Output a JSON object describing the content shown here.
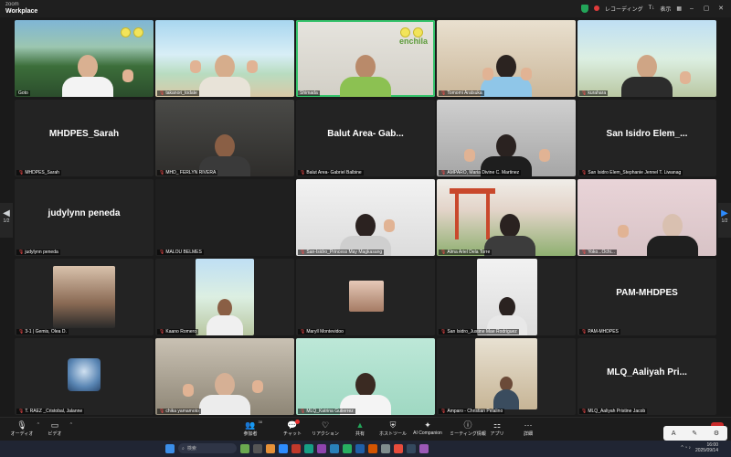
{
  "app": {
    "logo_line1": "zoom",
    "logo_line2": "Workplace"
  },
  "titlebar": {
    "recording_label": "レコーディング",
    "view_label": "表示",
    "ti_label": "T↓"
  },
  "pager": {
    "left": "1/2",
    "right": "1/2"
  },
  "tiles": [
    {
      "name": "Goto",
      "type": "video",
      "bg": "jungle",
      "active": false
    },
    {
      "name": "takanori_todate",
      "type": "video",
      "bg": "beach",
      "active": false,
      "mic_off": true
    },
    {
      "name": "Shimada",
      "type": "video",
      "bg": "room-light",
      "active": true,
      "overlay_text": "enchila"
    },
    {
      "name": "Tomomi Aratsuka",
      "type": "video",
      "bg": "room-warm",
      "active": false,
      "mic_off": true
    },
    {
      "name": "kurahara",
      "type": "video",
      "bg": "palm",
      "active": false,
      "mic_off": true
    },
    {
      "name": "MHDPES_Sarah",
      "type": "name",
      "display": "MHDPES_Sarah",
      "mic_off": true
    },
    {
      "name": "MHD_ FERLYN RIVERA",
      "type": "video",
      "bg": "dark",
      "mic_off": true
    },
    {
      "name": "Balut Area- Gabriel Balbine",
      "type": "name",
      "display": "Balut Area- Gab...",
      "mic_off": true
    },
    {
      "name": "AMPARO, Maria Divine C. Martinez",
      "type": "video",
      "bg": "gray",
      "mic_off": true
    },
    {
      "name": "San Isidro Elem_Stephanie Jennel T. Liwanag",
      "type": "name",
      "display": "San Isidro Elem_...",
      "mic_off": true
    },
    {
      "name": "judylynn peneda",
      "type": "name",
      "display": "judylynn peneda",
      "mic_off": true
    },
    {
      "name": "MALOU BELMES",
      "type": "blank",
      "mic_off": true
    },
    {
      "name": "San-Isidro_Princess May Magkasang",
      "type": "video",
      "bg": "white",
      "mic_off": true
    },
    {
      "name": "Alma Ariel Dela Torre",
      "type": "video",
      "bg": "torii",
      "mic_off": true
    },
    {
      "name": "Yoko...Ochi...",
      "type": "video",
      "bg": "origami",
      "mic_off": true
    },
    {
      "name": "3-1 | Gemis, Olea D.",
      "type": "photo",
      "mic_off": true
    },
    {
      "name": "Kaano Romero",
      "type": "video",
      "bg": "palm",
      "mic_off": true
    },
    {
      "name": "Maryll Montevidoo",
      "type": "photo-small",
      "mic_off": true
    },
    {
      "name": "San Isidro_Justine Mae Rodriguez",
      "type": "video",
      "bg": "white",
      "mic_off": true
    },
    {
      "name": "PAM-MHDPES",
      "type": "name",
      "display": "PAM-MHDPES",
      "mic_off": true
    },
    {
      "name": "T. RAEZ _Cristobal, Jalanne",
      "type": "avatar",
      "mic_off": true
    },
    {
      "name": "chika yamamoto",
      "type": "video",
      "bg": "kitchen",
      "mic_off": true
    },
    {
      "name": "MLQ_Katrina Gutierrez",
      "type": "video",
      "bg": "mint",
      "mic_off": true
    },
    {
      "name": "Amparo - Christian Pelalino",
      "type": "video",
      "bg": "shelf",
      "mic_off": true
    },
    {
      "name": "MLQ_Aaliyah Pristine Jacob",
      "type": "name",
      "display": "MLQ_Aaliyah Pri...",
      "mic_off": true
    }
  ],
  "toolbar": {
    "audio": "オーディオ",
    "video": "ビデオ",
    "participants": "参加者",
    "participants_count": "38",
    "chat": "チャット",
    "reactions": "リアクション",
    "share": "共有",
    "host_tools": "ホストツール",
    "ai_companion": "AI Companion",
    "meeting_info": "ミーティング情報",
    "apps": "アプリ",
    "more": "詳細"
  },
  "taskbar": {
    "search_placeholder": "検索",
    "time": "16:00",
    "date": "2025/09/14"
  },
  "colors": {
    "active_border": "#35c26b",
    "mic_off": "#ff4d4d",
    "accent": "#2d8cff"
  }
}
